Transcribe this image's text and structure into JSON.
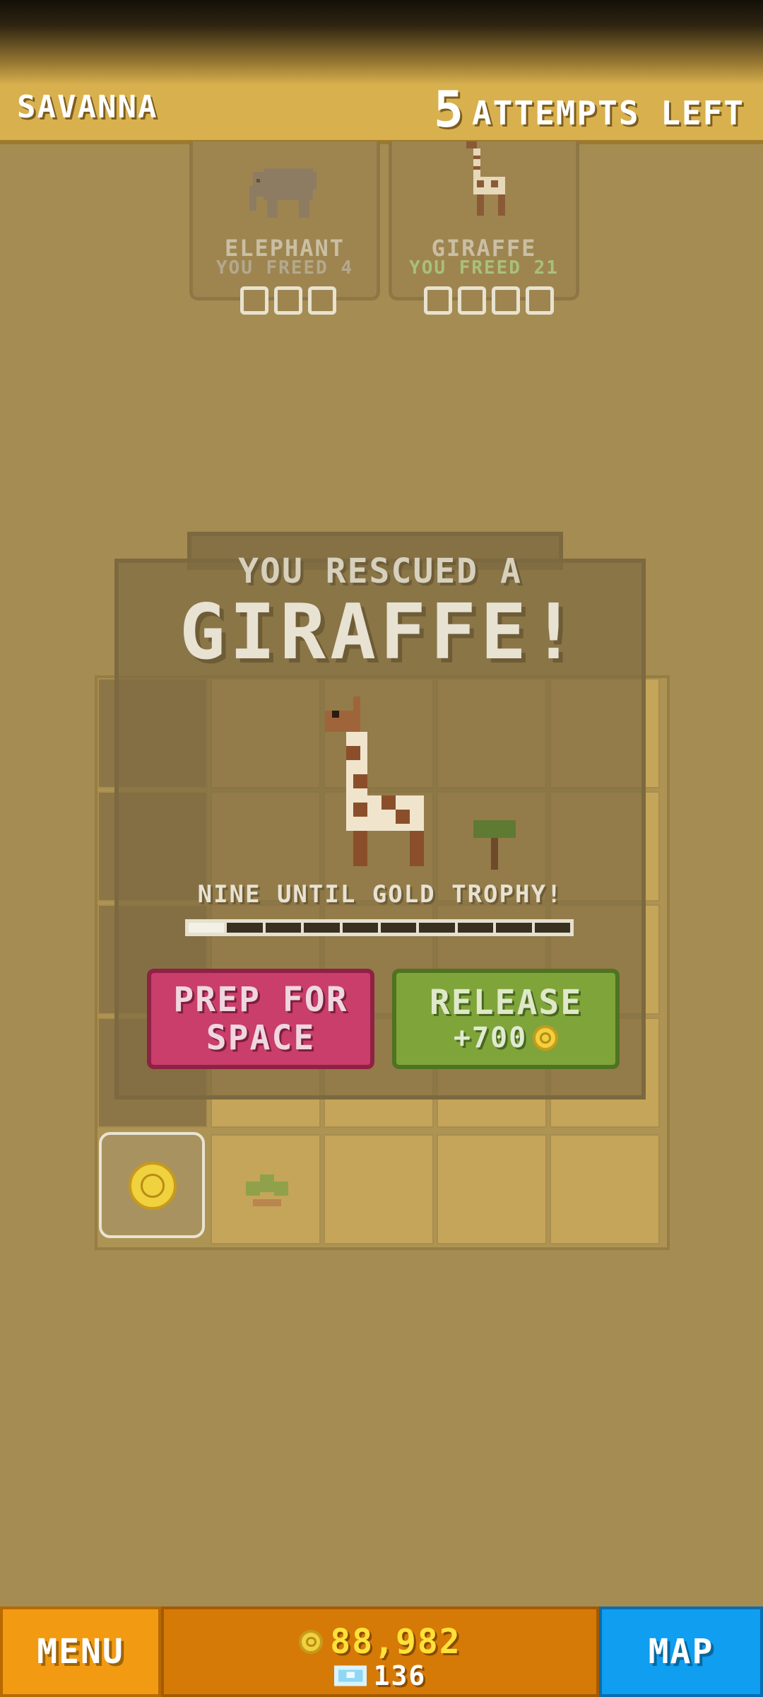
{
  "header": {
    "zone": "SAVANNA",
    "attempts_number": "5",
    "attempts_label": "ATTEMPTS LEFT"
  },
  "cards": [
    {
      "name": "ELEPHANT",
      "freed": "YOU FREED 4",
      "slots": 3,
      "icon": "elephant-icon"
    },
    {
      "name": "GIRAFFE",
      "freed": "YOU FREED 21",
      "slots": 4,
      "icon": "giraffe-icon"
    }
  ],
  "panel": {
    "rescued_line": "YOU RESCUED A",
    "animal": "GIRAFFE!",
    "trophy_text": "NINE UNTIL GOLD TROPHY!",
    "trophy_progress": "1 of 10",
    "prep_line1": "PREP FOR",
    "prep_line2": "SPACE",
    "release_label": "RELEASE",
    "release_reward": "+700"
  },
  "bottom": {
    "menu": "MENU",
    "coins": "88,982",
    "gems": "136",
    "map": "MAP"
  },
  "colors": {
    "prep": "#c93e6a",
    "release": "#7fa53a",
    "menu": "#f29a12",
    "map": "#0f9ef0",
    "coin": "#f0d13e"
  }
}
